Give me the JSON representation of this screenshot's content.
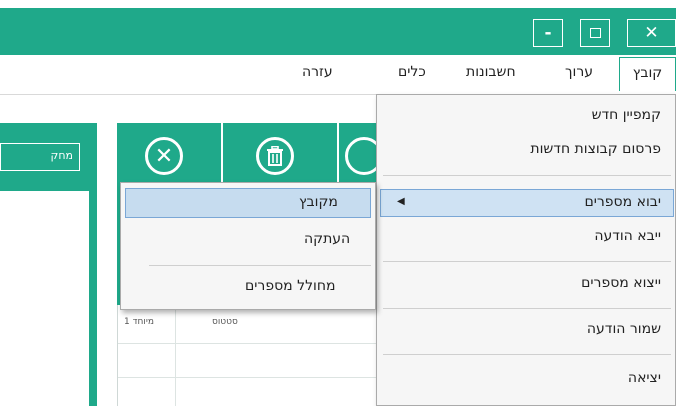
{
  "window": {
    "minimize_label": "-",
    "close_label": "✕"
  },
  "menubar": {
    "file": "קובץ",
    "edit": "ערוך",
    "accounts": "חשבונות",
    "tools": "כלים",
    "help": "עזרה"
  },
  "left_panel": {
    "search_label": "מחק"
  },
  "toolbar": {
    "close_icon": "close-circle-icon",
    "trash_icon": "trash-icon"
  },
  "table": {
    "columns": [
      "סטטוס",
      "מיוחד 1"
    ]
  },
  "file_menu": {
    "items": [
      "קמפיין חדש",
      "פרסום קבוצות חדשות",
      "יבוא מספרים",
      "ייבא הודעה",
      "ייצוא מספרים",
      "שמור הודעה",
      "יציאה"
    ],
    "highlighted_index": 2
  },
  "import_submenu": {
    "items": [
      "מקובץ",
      "העתקה",
      "מחולל מספרים"
    ],
    "highlighted_index": 0
  },
  "colors": {
    "accent": "#1fa98a",
    "highlight": "#cfe2f3"
  }
}
